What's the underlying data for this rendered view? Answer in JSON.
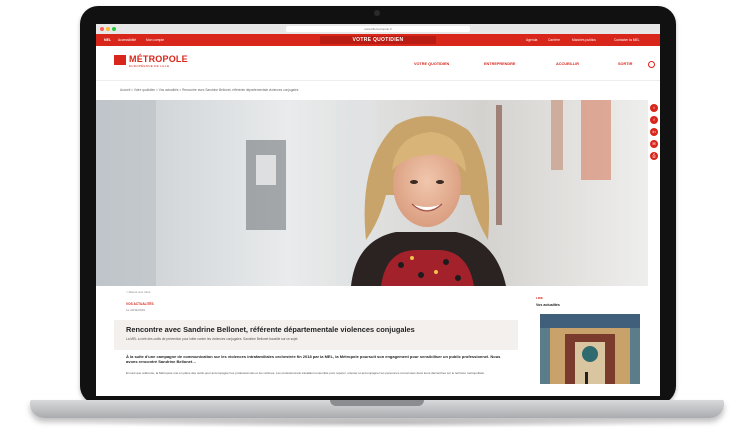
{
  "browser": {
    "url": "www.lillemetropole.fr"
  },
  "site": {
    "topbar": {
      "left_items": [
        "MEL",
        "Accessibilité",
        "Mon compte"
      ],
      "center": "VOTRE QUOTIDIEN",
      "right_items": [
        "Agenda",
        "Carrière",
        "Marchés publics",
        "Contacter la MEL"
      ]
    },
    "logo": {
      "word": "MÉTROPOLE",
      "sub": "EUROPÉENNE DE LILLE"
    },
    "nav": [
      "VOTRE QUOTIDIEN",
      "ENTREPRENDRE",
      "ACCUEILLIR",
      "SORTIR"
    ],
    "breadcrumb": "Accueil  >  Votre quotidien  >  Vos actualités  >  Rencontre avec Sandrine Bellonet, référente départementale violences conjugales"
  },
  "social": [
    "twitter",
    "facebook",
    "linkedin",
    "email",
    "print"
  ],
  "article": {
    "back": "< Retour aux infos",
    "category": "VOS ACTUALITÉS",
    "date": "Le 22/11/2019",
    "title": "Rencontre avec Sandrine Bellonet, référente départementale violences conjugales",
    "subtitle": "La MEL a créé des outils de prévention pour lutter contre les violences conjugales. Sandrine Bellonet travaille sur ce sujet.",
    "lead": "À la suite d'une campagne de communication sur les violences intrafamiliales orchestrée fin 2018 par la MEL, la Métropole poursuit son engagement pour sensibiliser un public professionnel. Nous avons rencontré Sandrine Bellonet…",
    "body": "En tant que référente, la Métropole met en place des outils pour accompagner les professionnels et les victimes. Les professionnels travaillent ensemble pour repérer, orienter et accompagner les personnes concernées dans leurs démarches sur le territoire métropolitain."
  },
  "sidebar": {
    "category": "LIRE",
    "title": "Vos actualités"
  }
}
